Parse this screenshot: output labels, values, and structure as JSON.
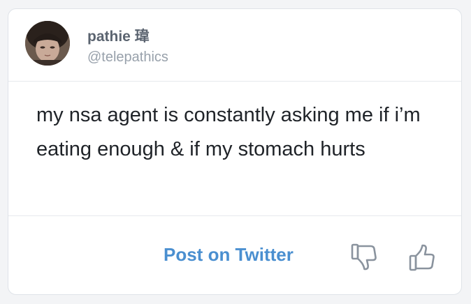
{
  "author": {
    "display_name": "pathie 瑋",
    "handle": "@telepathics",
    "avatar_icon": "user-avatar-photo"
  },
  "post": {
    "text": "my nsa agent is constantly asking me if i’m eating enough & if my stomach hurts"
  },
  "actions": {
    "post_on_twitter_label": "Post on Twitter",
    "dislike_icon": "thumbs-down-icon",
    "like_icon": "thumbs-up-icon"
  },
  "colors": {
    "link_blue": "#4a8fd0",
    "icon_gray": "#8a939e",
    "name_gray": "#5b6470",
    "handle_gray": "#98a1ab",
    "text_dark": "#1f2328",
    "border": "#dfe3e8"
  }
}
